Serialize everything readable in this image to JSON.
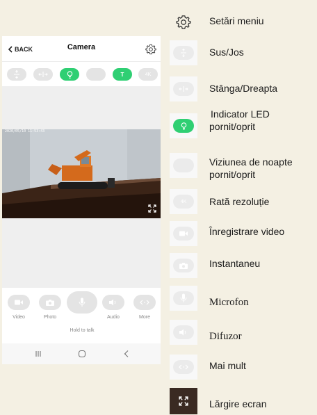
{
  "phone": {
    "header": {
      "back_label": "BACK",
      "title": "Camera"
    },
    "controls": [
      {
        "name": "up-down",
        "on": false,
        "text": ""
      },
      {
        "name": "left-right",
        "on": false,
        "text": ""
      },
      {
        "name": "led",
        "on": true,
        "text": ""
      },
      {
        "name": "night-vision",
        "on": false,
        "text": ""
      },
      {
        "name": "t",
        "on": true,
        "text": "T"
      },
      {
        "name": "resolution",
        "on": false,
        "text": "4K"
      }
    ],
    "video": {
      "timestamp": "2020/05/10 11:53:43"
    },
    "bottom": {
      "video_label": "Video",
      "photo_label": "Photo",
      "talk_label": "Hold to talk",
      "audio_label": "Audio",
      "more_label": "More"
    }
  },
  "legend": {
    "settings": "Setări meniu",
    "updown": "Sus/Jos",
    "leftright": "Stânga/Dreapta",
    "led_line1": "Indicator LED",
    "led_line2": "pornit/oprit",
    "night_line1": "Viziunea de noapte",
    "night_line2": "pornit/oprit",
    "resolution_icon": "4K",
    "resolution": "Rată rezoluție",
    "record": "Înregistrare video",
    "snapshot": "Instantaneu",
    "mic": "Microfon",
    "speaker": "Difuzor",
    "more": "Mai mult",
    "fullscreen": "Lărgire ecran"
  },
  "colors": {
    "accent_green": "#2fcf73",
    "pill_gray": "#e4e4e4",
    "background": "#f4f0e3"
  }
}
